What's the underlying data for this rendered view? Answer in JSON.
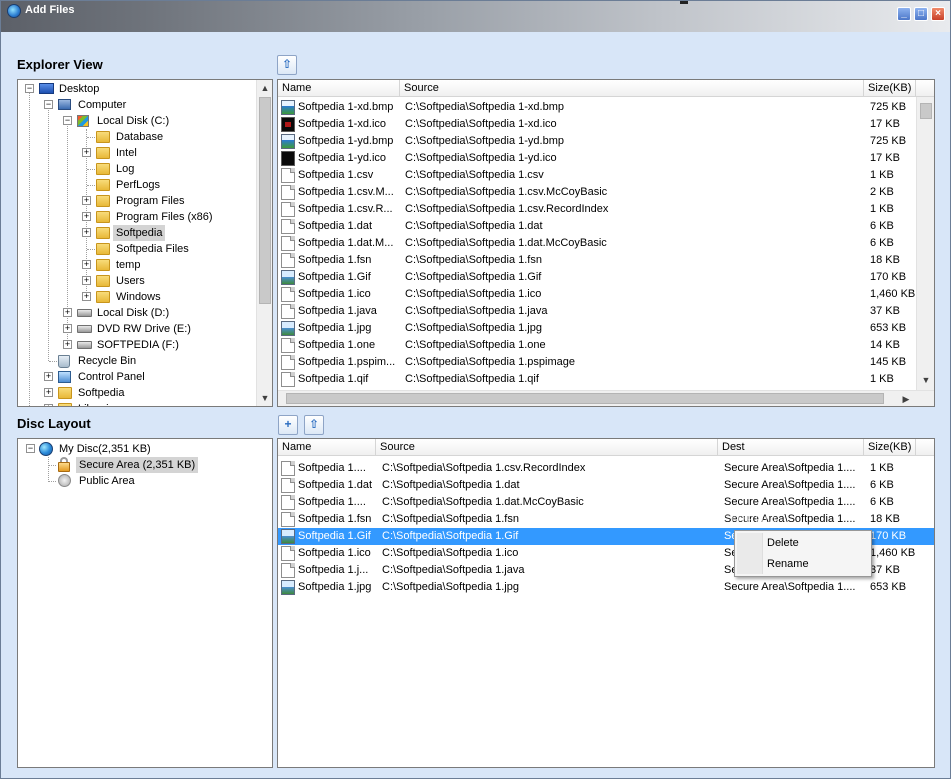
{
  "window": {
    "title": "Add Files",
    "minimize_glyph": "_",
    "maximize_glyph": "□",
    "close_glyph": "×"
  },
  "explorer": {
    "heading": "Explorer View",
    "up_button_glyph": "⇧",
    "tree": [
      {
        "label": "Desktop",
        "icon": "desktop-icon",
        "expander": "−"
      },
      {
        "label": "Computer",
        "icon": "computer-icon",
        "expander": "−"
      },
      {
        "label": "Local Disk (C:)",
        "icon": "windows-drive-icon",
        "expander": "−"
      },
      {
        "label": "Database",
        "icon": "folder-icon",
        "expander": ""
      },
      {
        "label": "Intel",
        "icon": "folder-icon",
        "expander": "+"
      },
      {
        "label": "Log",
        "icon": "folder-icon",
        "expander": ""
      },
      {
        "label": "PerfLogs",
        "icon": "folder-icon",
        "expander": ""
      },
      {
        "label": "Program Files",
        "icon": "folder-icon",
        "expander": "+"
      },
      {
        "label": "Program Files (x86)",
        "icon": "folder-icon",
        "expander": "+"
      },
      {
        "label": "Softpedia",
        "icon": "folder-icon",
        "expander": "+"
      },
      {
        "label": "Softpedia Files",
        "icon": "folder-icon",
        "expander": ""
      },
      {
        "label": "temp",
        "icon": "folder-icon",
        "expander": "+"
      },
      {
        "label": "Users",
        "icon": "folder-icon",
        "expander": "+"
      },
      {
        "label": "Windows",
        "icon": "folder-icon",
        "expander": "+"
      },
      {
        "label": "Local Disk (D:)",
        "icon": "drive-icon",
        "expander": "+"
      },
      {
        "label": "DVD RW Drive (E:)",
        "icon": "dvd-drive-icon",
        "expander": "+"
      },
      {
        "label": "SOFTPEDIA (F:)",
        "icon": "drive-icon",
        "expander": "+"
      },
      {
        "label": "Recycle Bin",
        "icon": "recycle-bin-icon",
        "expander": ""
      },
      {
        "label": "Control Panel",
        "icon": "control-panel-icon",
        "expander": "+"
      },
      {
        "label": "Softpedia",
        "icon": "user-folder-icon",
        "expander": "+"
      },
      {
        "label": "Libraries",
        "icon": "library-icon",
        "expander": "+"
      }
    ],
    "selected_tree_item": "Softpedia",
    "columns": [
      "Name",
      "Source",
      "Size(KB)"
    ],
    "files": [
      {
        "name": "Softpedia 1-xd.bmp",
        "source": "C:\\Softpedia\\Softpedia 1-xd.bmp",
        "size": "725 KB",
        "icon": "bmp"
      },
      {
        "name": "Softpedia 1-xd.ico",
        "source": "C:\\Softpedia\\Softpedia 1-xd.ico",
        "size": "17 KB",
        "icon": "ico-red"
      },
      {
        "name": "Softpedia 1-yd.bmp",
        "source": "C:\\Softpedia\\Softpedia 1-yd.bmp",
        "size": "725 KB",
        "icon": "bmp"
      },
      {
        "name": "Softpedia 1-yd.ico",
        "source": "C:\\Softpedia\\Softpedia 1-yd.ico",
        "size": "17 KB",
        "icon": "ico"
      },
      {
        "name": "Softpedia 1.csv",
        "source": "C:\\Softpedia\\Softpedia 1.csv",
        "size": "1 KB",
        "icon": "doc"
      },
      {
        "name": "Softpedia 1.csv.M...",
        "source": "C:\\Softpedia\\Softpedia 1.csv.McCoyBasic",
        "size": "2 KB",
        "icon": "doc"
      },
      {
        "name": "Softpedia 1.csv.R...",
        "source": "C:\\Softpedia\\Softpedia 1.csv.RecordIndex",
        "size": "1 KB",
        "icon": "doc"
      },
      {
        "name": "Softpedia 1.dat",
        "source": "C:\\Softpedia\\Softpedia 1.dat",
        "size": "6 KB",
        "icon": "doc"
      },
      {
        "name": "Softpedia 1.dat.M...",
        "source": "C:\\Softpedia\\Softpedia 1.dat.McCoyBasic",
        "size": "6 KB",
        "icon": "doc"
      },
      {
        "name": "Softpedia 1.fsn",
        "source": "C:\\Softpedia\\Softpedia 1.fsn",
        "size": "18 KB",
        "icon": "doc"
      },
      {
        "name": "Softpedia 1.Gif",
        "source": "C:\\Softpedia\\Softpedia 1.Gif",
        "size": "170 KB",
        "icon": "img"
      },
      {
        "name": "Softpedia 1.ico",
        "source": "C:\\Softpedia\\Softpedia 1.ico",
        "size": "1,460 KB",
        "icon": "doc"
      },
      {
        "name": "Softpedia 1.java",
        "source": "C:\\Softpedia\\Softpedia 1.java",
        "size": "37 KB",
        "icon": "doc"
      },
      {
        "name": "Softpedia 1.jpg",
        "source": "C:\\Softpedia\\Softpedia 1.jpg",
        "size": "653 KB",
        "icon": "img"
      },
      {
        "name": "Softpedia 1.one",
        "source": "C:\\Softpedia\\Softpedia 1.one",
        "size": "14 KB",
        "icon": "doc"
      },
      {
        "name": "Softpedia 1.pspim...",
        "source": "C:\\Softpedia\\Softpedia 1.pspimage",
        "size": "145 KB",
        "icon": "doc"
      },
      {
        "name": "Softpedia 1.qif",
        "source": "C:\\Softpedia\\Softpedia 1.qif",
        "size": "1 KB",
        "icon": "doc"
      }
    ]
  },
  "disc": {
    "heading": "Disc Layout",
    "new_folder_glyph": "+",
    "up_button_glyph": "⇧",
    "tree": [
      {
        "label": "My Disc(2,351 KB)",
        "icon": "globe-icon",
        "expander": "−"
      },
      {
        "label": "Secure Area (2,351 KB)",
        "icon": "lock-icon",
        "expander": ""
      },
      {
        "label": "Public Area",
        "icon": "public-area-icon",
        "expander": ""
      }
    ],
    "selected_tree_item": "Secure Area (2,351 KB)",
    "columns": [
      "Name",
      "Source",
      "Dest",
      "Size(KB)"
    ],
    "files": [
      {
        "name": "Softpedia 1....",
        "source": "C:\\Softpedia\\Softpedia 1.csv.RecordIndex",
        "dest": "Secure Area\\Softpedia 1....",
        "size": "1 KB",
        "icon": "doc"
      },
      {
        "name": "Softpedia 1.dat",
        "source": "C:\\Softpedia\\Softpedia 1.dat",
        "dest": "Secure Area\\Softpedia 1....",
        "size": "6 KB",
        "icon": "doc"
      },
      {
        "name": "Softpedia 1....",
        "source": "C:\\Softpedia\\Softpedia 1.dat.McCoyBasic",
        "dest": "Secure Area\\Softpedia 1....",
        "size": "6 KB",
        "icon": "doc"
      },
      {
        "name": "Softpedia 1.fsn",
        "source": "C:\\Softpedia\\Softpedia 1.fsn",
        "dest": "Secure Area\\Softpedia 1....",
        "size": "18 KB",
        "icon": "doc"
      },
      {
        "name": "Softpedia 1.Gif",
        "source": "C:\\Softpedia\\Softpedia 1.Gif",
        "dest": "Se",
        "size": "170 KB",
        "icon": "img"
      },
      {
        "name": "Softpedia 1.ico",
        "source": "C:\\Softpedia\\Softpedia 1.ico",
        "dest": "Se",
        "size": "1,460 KB",
        "icon": "doc"
      },
      {
        "name": "Softpedia 1.j...",
        "source": "C:\\Softpedia\\Softpedia 1.java",
        "dest": "Se",
        "size": "37 KB",
        "icon": "doc"
      },
      {
        "name": "Softpedia 1.jpg",
        "source": "C:\\Softpedia\\Softpedia 1.jpg",
        "dest": "Secure Area\\Softpedia 1....",
        "size": "653 KB",
        "icon": "img"
      }
    ],
    "selected_row_index": 4
  },
  "context_menu": {
    "items": [
      {
        "label": "Delete",
        "accel": "D"
      },
      {
        "label": "Rename",
        "accel": "R"
      }
    ]
  },
  "watermark": "SOFTPEDIA",
  "scroll_glyphs": {
    "up": "▲",
    "down": "▼",
    "left": "◀",
    "right": "▶"
  },
  "colors": {
    "selection": "#3399ff",
    "window_bg": "#d8e6f8"
  }
}
